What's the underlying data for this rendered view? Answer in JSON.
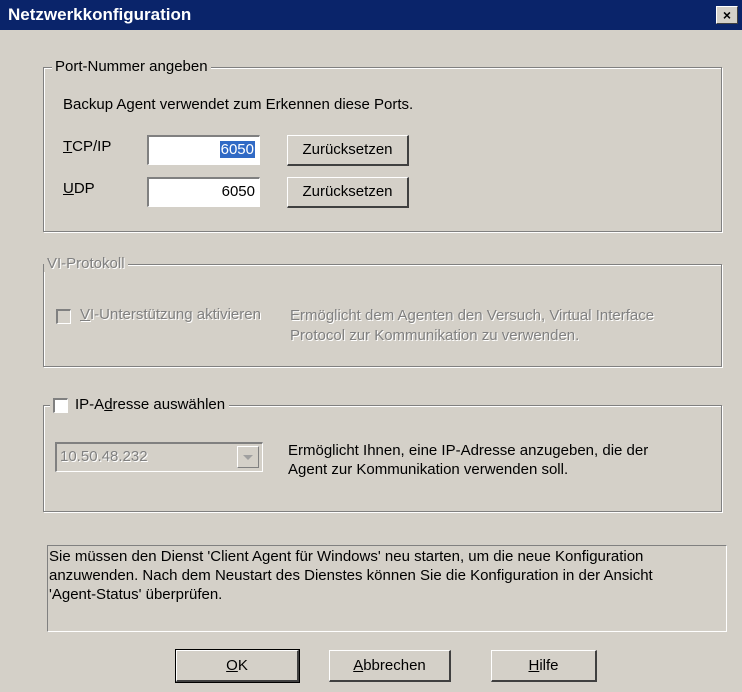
{
  "window": {
    "title": "Netzwerkkonfiguration",
    "close_glyph": "×"
  },
  "port_group": {
    "legend": "Port-Nummer angeben",
    "description": "Backup Agent verwendet zum Erkennen diese Ports.",
    "tcp": {
      "label_mnemonic": "T",
      "label_rest": "CP/IP",
      "value": "6050",
      "reset_label": "Zurücksetzen"
    },
    "udp": {
      "label_mnemonic": "U",
      "label_rest": "DP",
      "value": "6050",
      "reset_label": "Zurücksetzen"
    }
  },
  "vi_group": {
    "legend": "VI-Protokoll",
    "checkbox_mnemonic": "V",
    "checkbox_rest": "I-Unterstützung aktivieren",
    "checked": false,
    "description_line1": "Ermöglicht dem Agenten den Versuch, Virtual Interface",
    "description_line2": "Protocol zur Kommunikation zu verwenden."
  },
  "ip_group": {
    "checkbox_pre": "IP-A",
    "checkbox_mnemonic": "d",
    "checkbox_post": "resse auswählen",
    "checked": false,
    "selected_ip": "10.50.48.232",
    "description_line1": "Ermöglicht Ihnen, eine IP-Adresse anzugeben, die der",
    "description_line2": "Agent zur Kommunikation verwenden soll."
  },
  "info": {
    "line1": "Sie müssen den Dienst 'Client Agent für Windows' neu starten, um die neue Konfiguration",
    "line2": "anzuwenden. Nach dem Neustart des Dienstes können Sie die Konfiguration in der Ansicht",
    "line3": "'Agent-Status' überprüfen."
  },
  "buttons": {
    "ok": {
      "mnemonic": "O",
      "rest": "K"
    },
    "cancel": {
      "mnemonic": "A",
      "rest": "bbrechen"
    },
    "help": {
      "mnemonic": "H",
      "rest": "ilfe"
    }
  },
  "colors": {
    "titlebar": "#0a246a",
    "dialog_bg": "#d4d0c8",
    "selection": "#316ac5",
    "disabled_text": "#808080"
  }
}
